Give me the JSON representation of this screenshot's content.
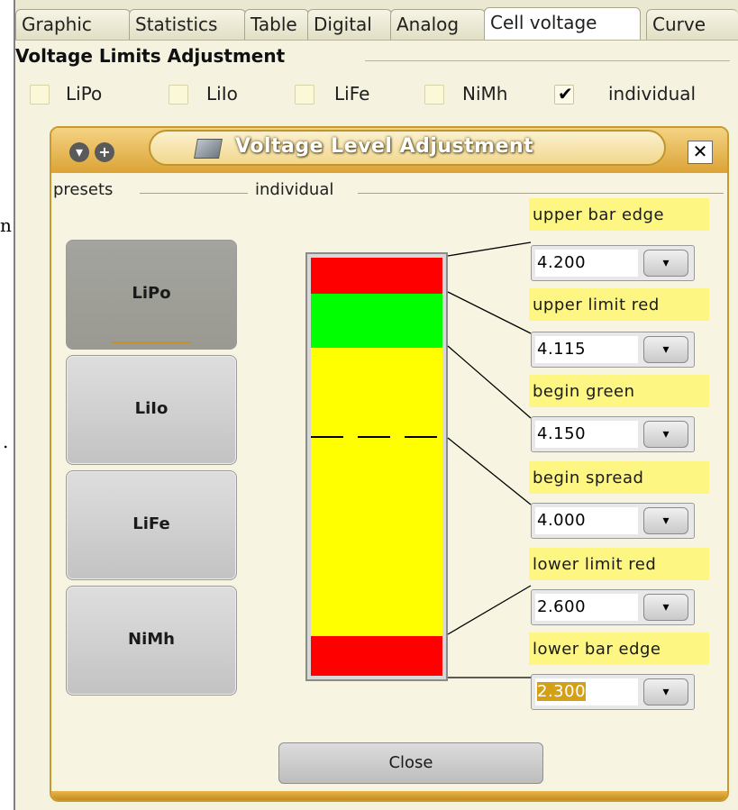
{
  "tabs": [
    "Graphic",
    "Statistics",
    "Table",
    "Digital",
    "Analog",
    "Cell voltage",
    "Curve"
  ],
  "active_tab": "Cell voltage",
  "group_title": "Voltage Limits Adjustment",
  "checkboxes": [
    {
      "label": "LiPo",
      "checked": false
    },
    {
      "label": "LiIo",
      "checked": false
    },
    {
      "label": "LiFe",
      "checked": false
    },
    {
      "label": "NiMh",
      "checked": false
    },
    {
      "label": "individual",
      "checked": true
    }
  ],
  "dialog": {
    "title": "Voltage Level Adjustment",
    "presets_label": "presets",
    "individual_label": "individual",
    "presets": [
      "LiPo",
      "LiIo",
      "LiFe",
      "NiMh"
    ],
    "pressed_preset": "LiPo",
    "fields": [
      {
        "label": "upper bar edge",
        "value": "4.200"
      },
      {
        "label": "upper limit red",
        "value": "4.115"
      },
      {
        "label": "begin green",
        "value": "4.150"
      },
      {
        "label": "begin spread",
        "value": "4.000"
      },
      {
        "label": "lower limit red",
        "value": "2.600"
      },
      {
        "label": "lower bar edge",
        "value": "2.300"
      }
    ],
    "close_label": "Close"
  },
  "colors": {
    "red": "#ff0000",
    "green": "#00ff00",
    "yellow": "#ffff00",
    "accent": "#dca336"
  }
}
